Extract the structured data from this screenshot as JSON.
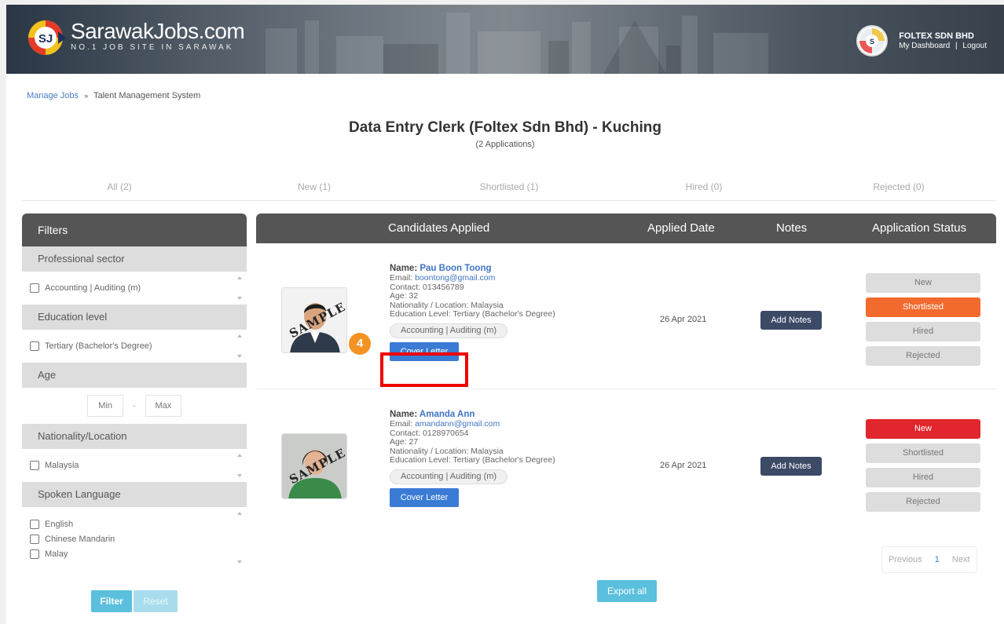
{
  "header": {
    "logo_title": "SarawakJobs.com",
    "logo_sub": "NO.1 JOB SITE IN SARAWAK",
    "company": "FOLTEX SDN BHD",
    "dashboard_link": "My Dashboard",
    "divider": "|",
    "logout_link": "Logout"
  },
  "breadcrumb": {
    "link": "Manage Jobs",
    "separator": "»",
    "current": "Talent Management System"
  },
  "job": {
    "title": "Data Entry Clerk (Foltex Sdn Bhd) - Kuching",
    "subtitle": "(2 Applications)"
  },
  "tabs": [
    "All (2)",
    "New (1)",
    "Shortlisted (1)",
    "Hired (0)",
    "Rejected (0)"
  ],
  "filters": {
    "title": "Filters",
    "professional_sector": {
      "label": "Professional sector",
      "options": [
        "Accounting | Auditing (m)"
      ]
    },
    "education_level": {
      "label": "Education level",
      "options": [
        "Tertiary (Bachelor's Degree)"
      ]
    },
    "age": {
      "label": "Age",
      "min_placeholder": "Min",
      "dash": "-",
      "max_placeholder": "Max"
    },
    "nationality": {
      "label": "Nationality/Location",
      "options": [
        "Malaysia"
      ]
    },
    "spoken_language": {
      "label": "Spoken Language",
      "options": [
        "English",
        "Chinese Mandarin",
        "Malay"
      ]
    },
    "filter_button": "Filter",
    "reset_button": "Reset"
  },
  "table": {
    "headers": {
      "candidates": "Candidates Applied",
      "applied_date": "Applied Date",
      "notes": "Notes",
      "status": "Application Status"
    },
    "status_options": [
      "New",
      "Shortlisted",
      "Hired",
      "Rejected"
    ],
    "candidates": [
      {
        "name_label": "Name: ",
        "name": "Pau Boon Toong",
        "email_label": "Email: ",
        "email": "boontong@gmail.com",
        "contact": "Contact: 013456789",
        "age": "Age: 32",
        "nationality": "Nationality / Location: Malaysia",
        "education": "Education Level: Tertiary (Bachelor's Degree)",
        "tag": "Accounting | Auditing (m)",
        "cover_letter": "Cover Letter",
        "applied_date": "26 Apr 2021",
        "notes_button": "Add Notes",
        "active_status": "Shortlisted",
        "photo_stamp": "SAMPLE"
      },
      {
        "name_label": "Name: ",
        "name": "Amanda Ann",
        "email_label": "Email: ",
        "email": "amandann@gmail.com",
        "contact": "Contact: 0128970654",
        "age": "Age: 27",
        "nationality": "Nationality / Location: Malaysia",
        "education": "Education Level: Tertiary (Bachelor's Degree)",
        "tag": "Accounting | Auditing (m)",
        "cover_letter": "Cover Letter",
        "applied_date": "26 Apr 2021",
        "notes_button": "Add Notes",
        "active_status": "New",
        "photo_stamp": "SAMPLE"
      }
    ]
  },
  "annotation": {
    "step_badge": "4"
  },
  "pagination": {
    "previous": "Previous",
    "current": "1",
    "next": "Next"
  },
  "export_button": "Export all",
  "colors": {
    "header_dark": "#555555",
    "link_blue": "#3f74c4",
    "primary_button": "#3a7bd5",
    "shortlisted_active": "#f26a2e",
    "new_active": "#e1262d",
    "notes_button": "#3c4a66",
    "filter_button": "#5bc0de",
    "highlight": "#ee0000",
    "step_badge": "#f39322"
  }
}
